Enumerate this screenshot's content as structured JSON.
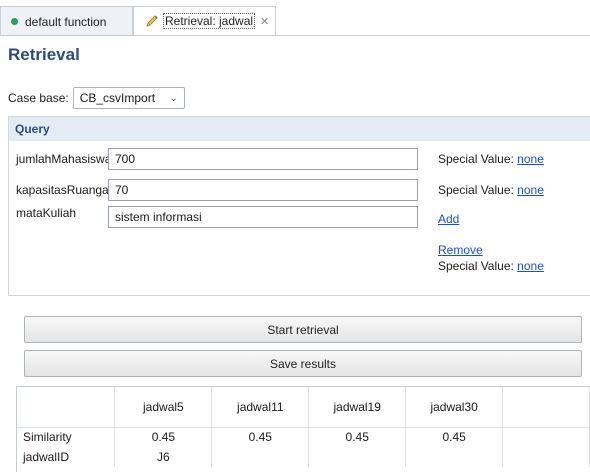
{
  "tabs": [
    {
      "label": "default function",
      "active": false
    },
    {
      "label": "Retrieval: jadwal",
      "active": true
    }
  ],
  "colors": {
    "heading": "#2f4d7a",
    "link": "#1b4fd6",
    "section_header_bg": "#e3ebf5",
    "status_dot": "#2e9c5a"
  },
  "heading": "Retrieval",
  "case_base": {
    "label": "Case base:",
    "selected": "CB_csvImport"
  },
  "query": {
    "title": "Query",
    "fields": [
      {
        "label": "jumlahMahasiswa",
        "value": "700",
        "special_label": "Special Value:",
        "special_link": "none"
      },
      {
        "label": "kapasitasRuangan",
        "value": "70",
        "special_label": "Special Value:",
        "special_link": "none"
      },
      {
        "label": "mataKuliah",
        "value": "sistem informasi",
        "add_link": "Add",
        "remove_link": "Remove",
        "special_label": "Special Value:",
        "special_link": "none"
      }
    ]
  },
  "buttons": {
    "start": "Start retrieval",
    "save": "Save results"
  },
  "results": {
    "columns": [
      "",
      "jadwal5",
      "jadwal11",
      "jadwal19",
      "jadwal30",
      ""
    ],
    "rows": [
      [
        "Similarity",
        "0.45",
        "0.45",
        "0.45",
        "0.45",
        ""
      ],
      [
        "jadwalID",
        "J6",
        "",
        "",
        "",
        ""
      ]
    ]
  }
}
